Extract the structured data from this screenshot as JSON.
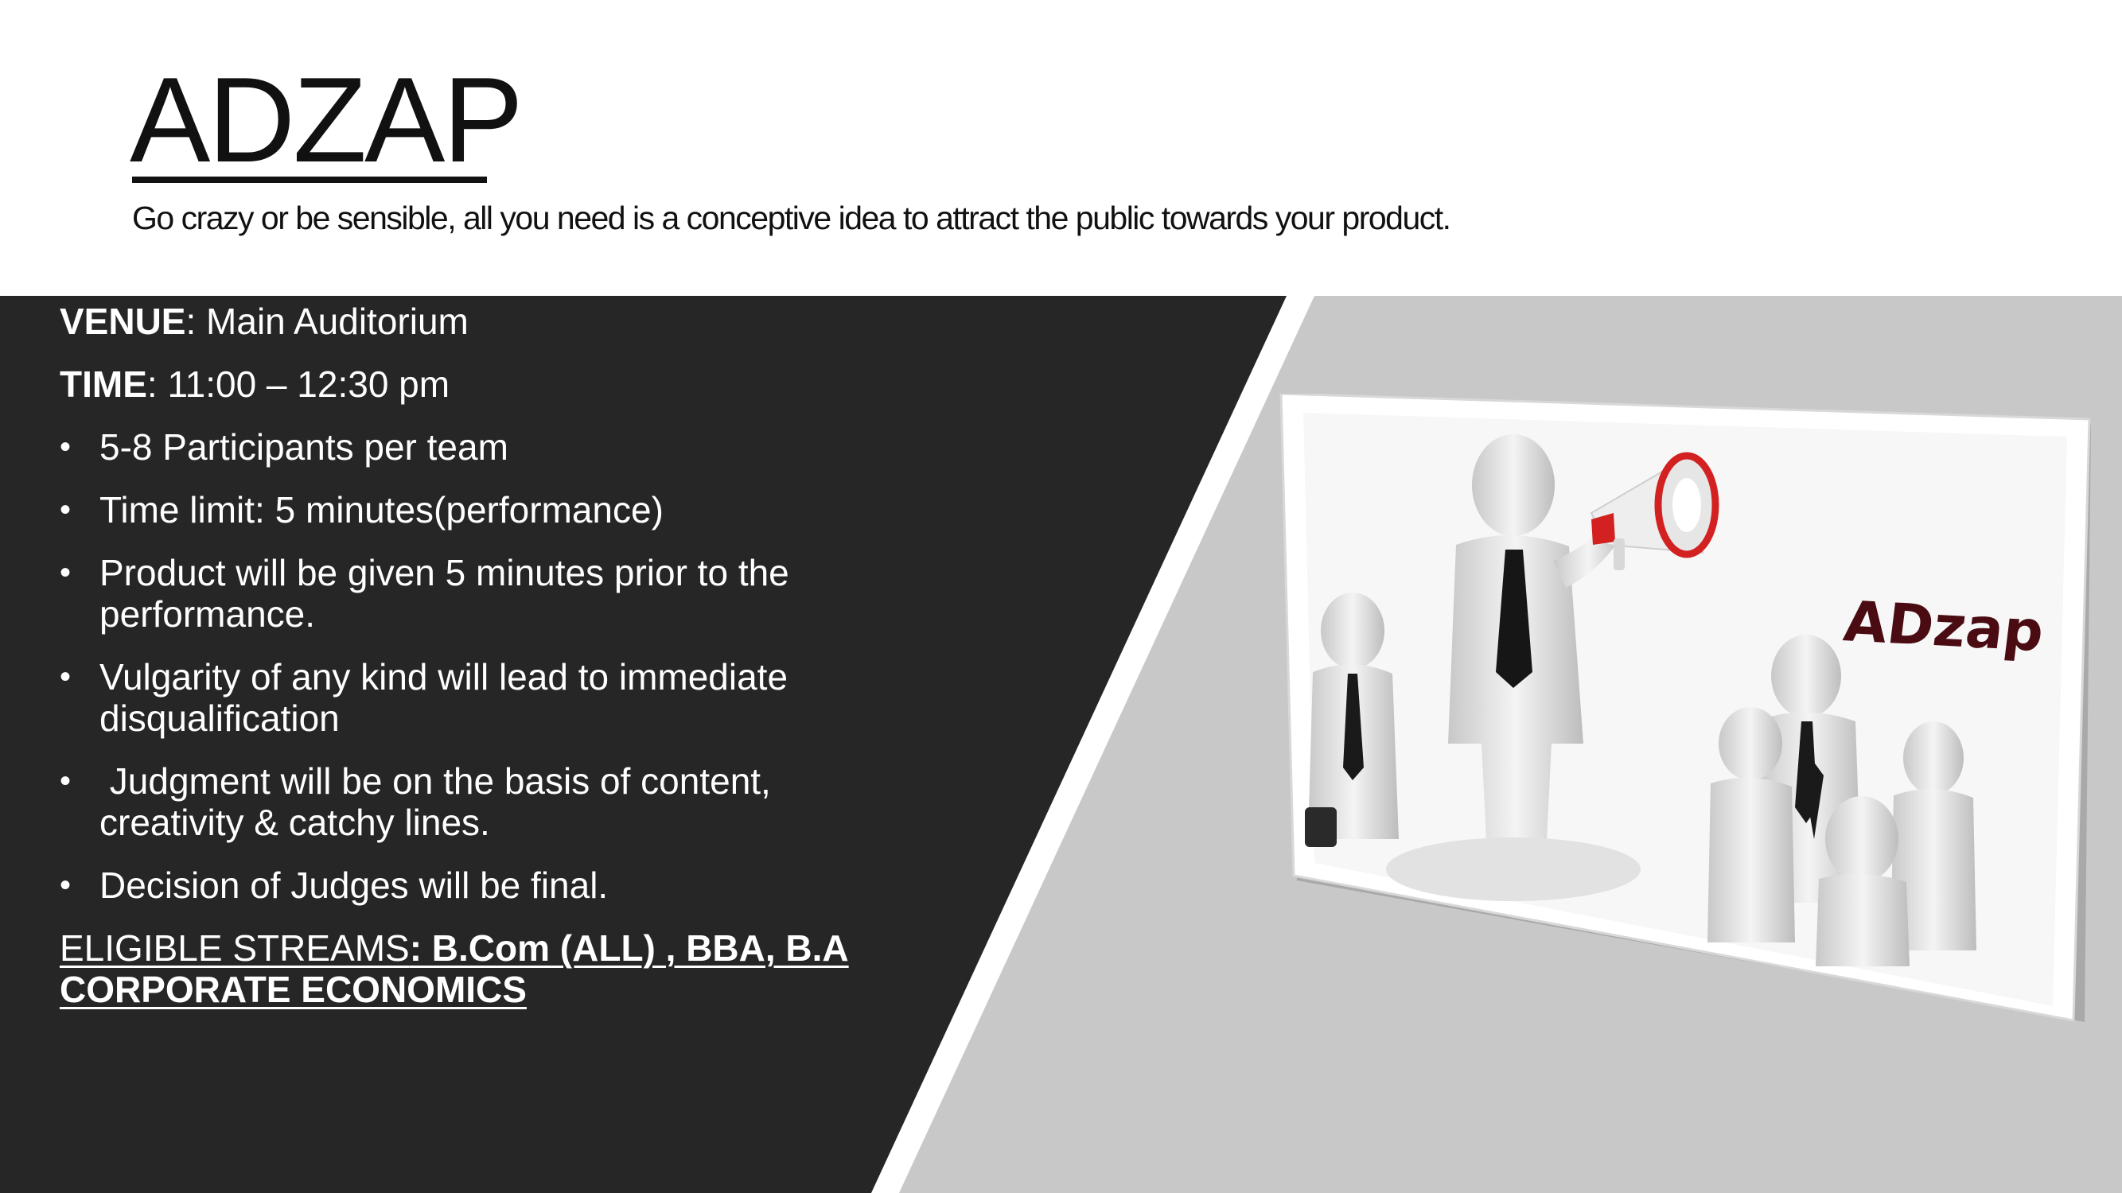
{
  "header": {
    "title": "ADZAP",
    "subtitle": "Go crazy or be sensible, all you need is a conceptive idea to attract the public towards your product."
  },
  "details": {
    "venue_label": "VENUE",
    "venue_value": ": Main Auditorium",
    "time_label": "TIME",
    "time_value": ": 11:00 – 12:30 pm"
  },
  "rules": [
    "5-8 Participants per team",
    "Time limit: 5 minutes(performance)",
    "Product will be given 5 minutes prior to the performance.",
    "Vulgarity of any kind will lead to immediate disqualification",
    " Judgment will be on the basis of content, creativity & catchy lines.",
    "Decision of Judges will be final."
  ],
  "bullet_symbol": "•",
  "eligibility": {
    "label": "ELIGIBLE STREAMS",
    "value": ": B.Com (ALL) , BBA, B.A CORPORATE ECONOMICS"
  },
  "image": {
    "logo_text": "ADzap"
  },
  "colors": {
    "dark_panel": "#262626",
    "grey_panel": "#c8c8c8",
    "accent_red": "#d32020",
    "logo_text": "#4a0c12"
  },
  "icons": [
    "megaphone-icon"
  ]
}
